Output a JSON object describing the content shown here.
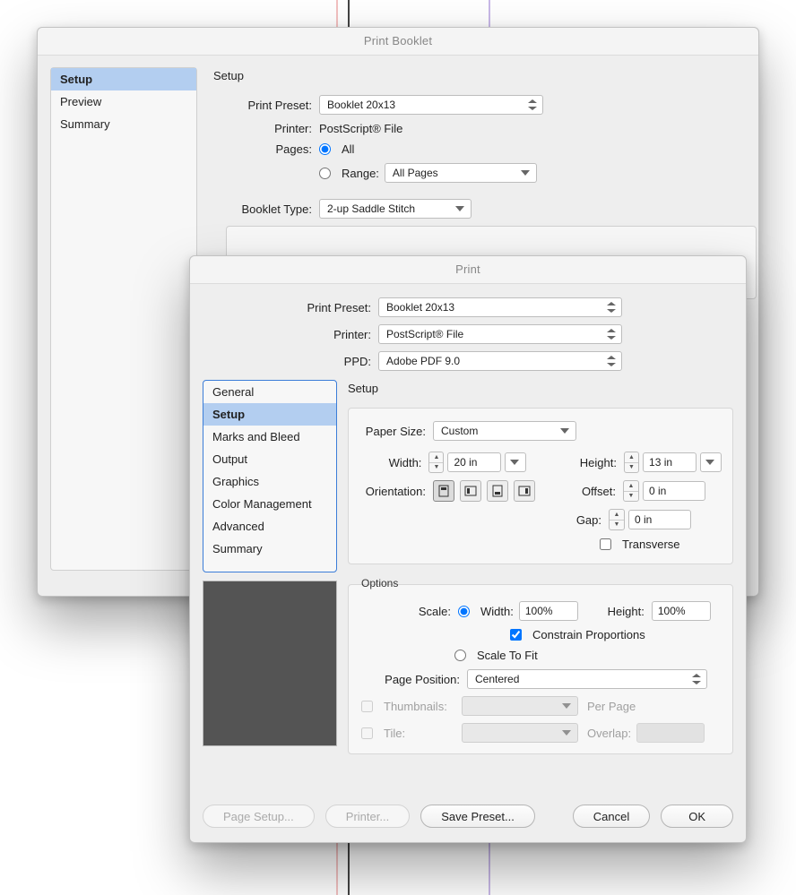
{
  "rulers": {
    "r1": 375,
    "r2": 388,
    "r3": 545
  },
  "booklet": {
    "title": "Print Booklet",
    "sidebar": [
      "Setup",
      "Preview",
      "Summary"
    ],
    "selected": 0,
    "heading": "Setup",
    "labels": {
      "preset": "Print Preset:",
      "printer": "Printer:",
      "pages": "Pages:",
      "all": "All",
      "range": "Range:",
      "bookletType": "Booklet Type:"
    },
    "preset": "Booklet 20x13",
    "printer": "PostScript® File",
    "rangeSelect": "All Pages",
    "bookletType": "2-up Saddle Stitch"
  },
  "print": {
    "title": "Print",
    "labels": {
      "preset": "Print Preset:",
      "printer": "Printer:",
      "ppd": "PPD:"
    },
    "preset": "Booklet 20x13",
    "printer": "PostScript® File",
    "ppd": "Adobe PDF 9.0",
    "sidebar": [
      "General",
      "Setup",
      "Marks and Bleed",
      "Output",
      "Graphics",
      "Color Management",
      "Advanced",
      "Summary"
    ],
    "selected": 1,
    "heading": "Setup",
    "paperSizeLabel": "Paper Size:",
    "paperSize": "Custom",
    "widthLabel": "Width:",
    "width": "20 in",
    "heightLabel": "Height:",
    "height": "13 in",
    "orientationLabel": "Orientation:",
    "offsetLabel": "Offset:",
    "offset": "0 in",
    "gapLabel": "Gap:",
    "gap": "0 in",
    "transverse": "Transverse",
    "options": {
      "title": "Options",
      "scaleLabel": "Scale:",
      "scaleWidthLabel": "Width:",
      "scaleWidth": "100%",
      "scaleHeightLabel": "Height:",
      "scaleHeight": "100%",
      "constrain": "Constrain Proportions",
      "scaleToFit": "Scale To Fit",
      "pagePositionLabel": "Page Position:",
      "pagePosition": "Centered",
      "thumbnails": "Thumbnails:",
      "perPage": "Per Page",
      "tile": "Tile:",
      "overlap": "Overlap:"
    },
    "buttons": {
      "pageSetup": "Page Setup...",
      "printer": "Printer...",
      "savePreset": "Save Preset...",
      "cancel": "Cancel",
      "ok": "OK"
    }
  }
}
